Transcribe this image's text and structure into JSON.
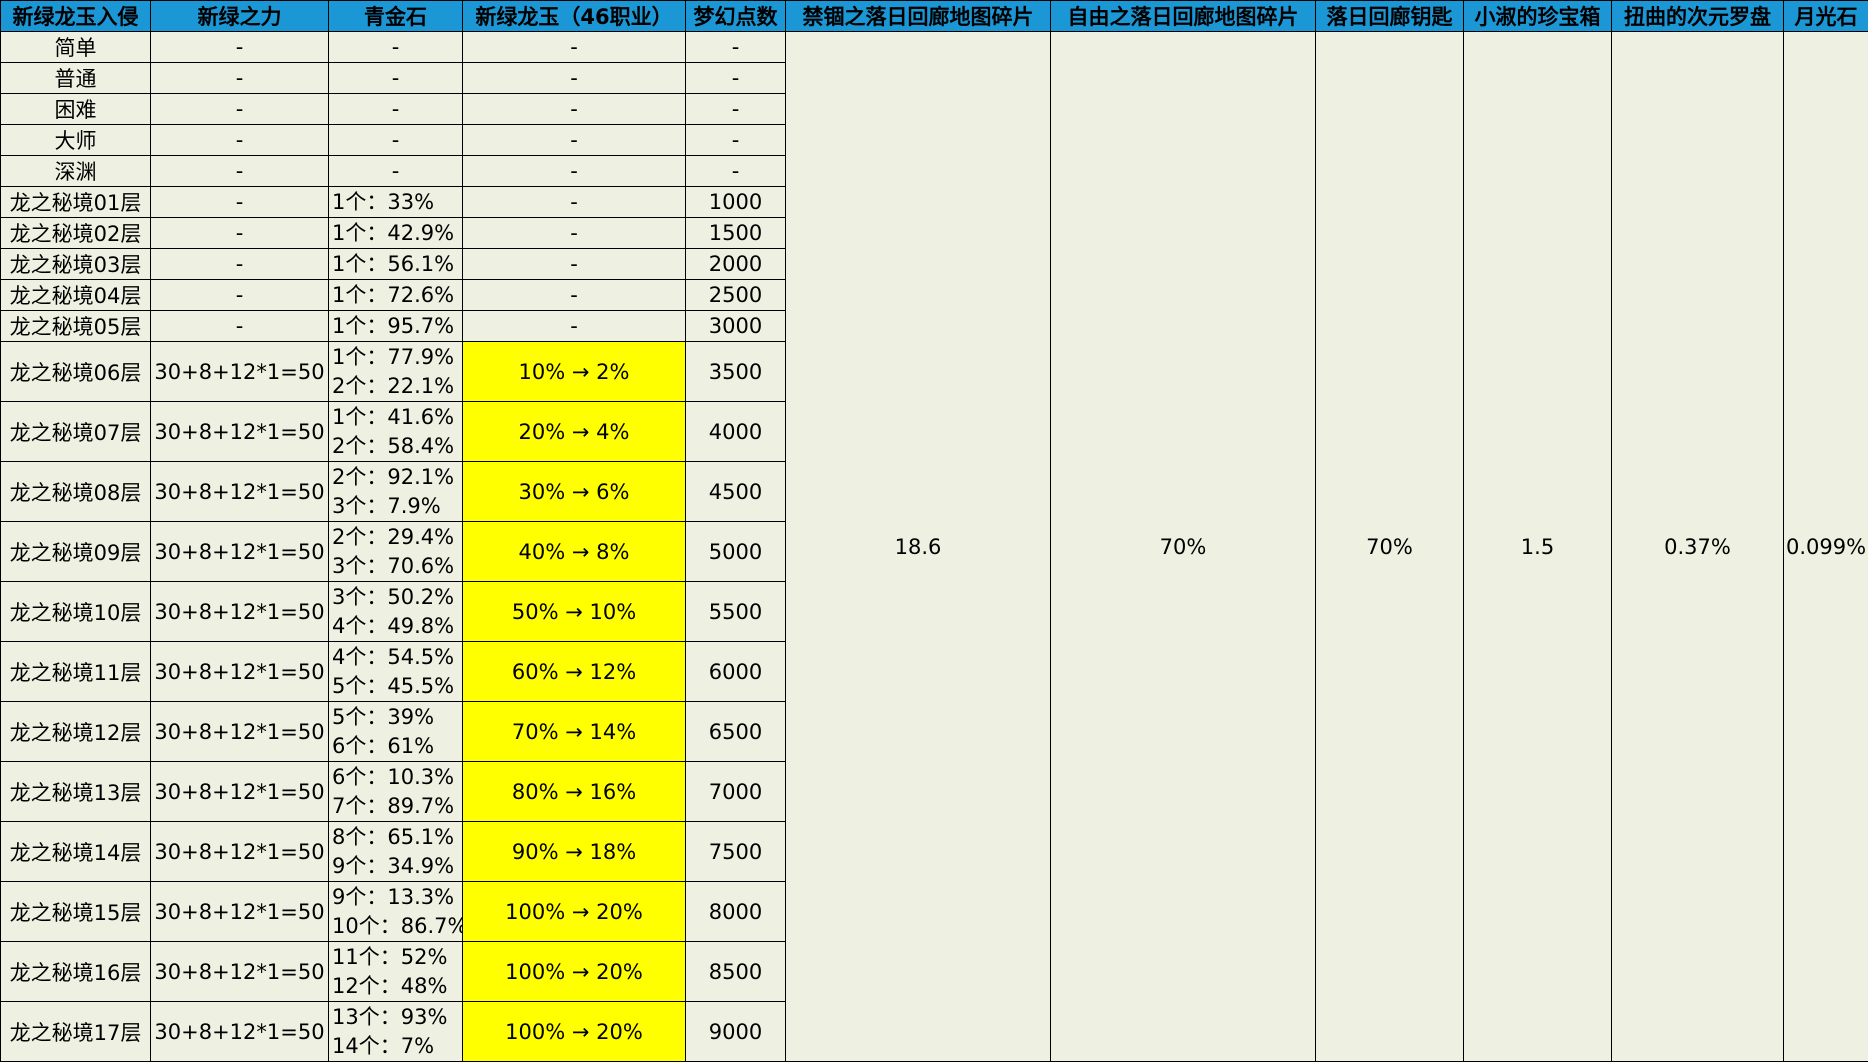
{
  "headers": [
    "新绿龙玉入侵",
    "新绿之力",
    "青金石",
    "新绿龙玉（46职业）",
    "梦幻点数",
    "禁锢之落日回廊地图碎片",
    "自由之落日回廊地图碎片",
    "落日回廊钥匙",
    "小淑的珍宝箱",
    "扭曲的次元罗盘",
    "月光石"
  ],
  "merged_values": [
    "18.6",
    "70%",
    "70%",
    "1.5",
    "0.37%",
    "0.099%"
  ],
  "rows": [
    {
      "name": "简单",
      "power": "-",
      "lapis": [
        "-"
      ],
      "jade": "-",
      "points": "-"
    },
    {
      "name": "普通",
      "power": "-",
      "lapis": [
        "-"
      ],
      "jade": "-",
      "points": "-"
    },
    {
      "name": "困难",
      "power": "-",
      "lapis": [
        "-"
      ],
      "jade": "-",
      "points": "-"
    },
    {
      "name": "大师",
      "power": "-",
      "lapis": [
        "-"
      ],
      "jade": "-",
      "points": "-"
    },
    {
      "name": "深渊",
      "power": "-",
      "lapis": [
        "-"
      ],
      "jade": "-",
      "points": "-"
    },
    {
      "name": "龙之秘境01层",
      "power": "-",
      "lapis": [
        "1个：33%"
      ],
      "jade": "-",
      "points": "1000"
    },
    {
      "name": "龙之秘境02层",
      "power": "-",
      "lapis": [
        "1个：42.9%"
      ],
      "jade": "-",
      "points": "1500"
    },
    {
      "name": "龙之秘境03层",
      "power": "-",
      "lapis": [
        "1个：56.1%"
      ],
      "jade": "-",
      "points": "2000"
    },
    {
      "name": "龙之秘境04层",
      "power": "-",
      "lapis": [
        "1个：72.6%"
      ],
      "jade": "-",
      "points": "2500"
    },
    {
      "name": "龙之秘境05层",
      "power": "-",
      "lapis": [
        "1个：95.7%"
      ],
      "jade": "-",
      "points": "3000"
    },
    {
      "name": "龙之秘境06层",
      "power": "30+8+12*1=50",
      "lapis": [
        "1个：77.9%",
        "2个：22.1%"
      ],
      "jade": "10% → 2%",
      "points": "3500"
    },
    {
      "name": "龙之秘境07层",
      "power": "30+8+12*1=50",
      "lapis": [
        "1个：41.6%",
        "2个：58.4%"
      ],
      "jade": "20% → 4%",
      "points": "4000"
    },
    {
      "name": "龙之秘境08层",
      "power": "30+8+12*1=50",
      "lapis": [
        "2个：92.1%",
        "3个：7.9%"
      ],
      "jade": "30% → 6%",
      "points": "4500"
    },
    {
      "name": "龙之秘境09层",
      "power": "30+8+12*1=50",
      "lapis": [
        "2个：29.4%",
        "3个：70.6%"
      ],
      "jade": "40% → 8%",
      "points": "5000"
    },
    {
      "name": "龙之秘境10层",
      "power": "30+8+12*1=50",
      "lapis": [
        "3个：50.2%",
        "4个：49.8%"
      ],
      "jade": "50% → 10%",
      "points": "5500"
    },
    {
      "name": "龙之秘境11层",
      "power": "30+8+12*1=50",
      "lapis": [
        "4个：54.5%",
        "5个：45.5%"
      ],
      "jade": "60% → 12%",
      "points": "6000"
    },
    {
      "name": "龙之秘境12层",
      "power": "30+8+12*1=50",
      "lapis": [
        "5个：39%",
        "6个：61%"
      ],
      "jade": "70% → 14%",
      "points": "6500"
    },
    {
      "name": "龙之秘境13层",
      "power": "30+8+12*1=50",
      "lapis": [
        "6个：10.3%",
        "7个：89.7%"
      ],
      "jade": "80% → 16%",
      "points": "7000"
    },
    {
      "name": "龙之秘境14层",
      "power": "30+8+12*1=50",
      "lapis": [
        "8个：65.1%",
        "9个：34.9%"
      ],
      "jade": "90% → 18%",
      "points": "7500"
    },
    {
      "name": "龙之秘境15层",
      "power": "30+8+12*1=50",
      "lapis": [
        "9个：13.3%",
        "10个：86.7%"
      ],
      "jade": "100% → 20%",
      "points": "8000"
    },
    {
      "name": "龙之秘境16层",
      "power": "30+8+12*1=50",
      "lapis": [
        "11个：52%",
        "12个：48%"
      ],
      "jade": "100% → 20%",
      "points": "8500"
    },
    {
      "name": "龙之秘境17层",
      "power": "30+8+12*1=50",
      "lapis": [
        "13个：93%",
        "14个：7%"
      ],
      "jade": "100% → 20%",
      "points": "9000"
    }
  ],
  "colors": {
    "header_bg": "#1c97d6",
    "cell_bg": "#eef1e2",
    "highlight": "#ffff00"
  }
}
